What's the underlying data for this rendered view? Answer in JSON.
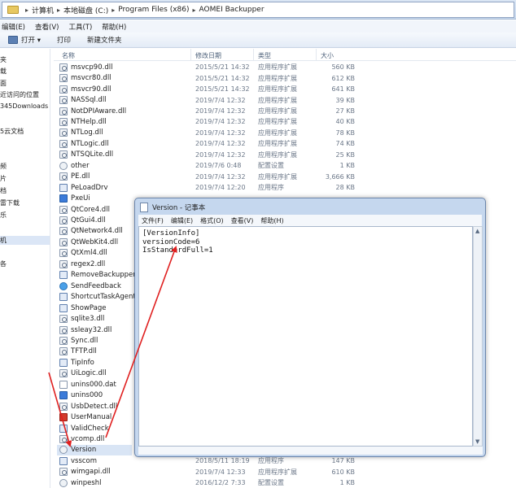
{
  "address": {
    "crumbs": [
      "计算机",
      "本地磁盘 (C:)",
      "Program Files (x86)",
      "AOMEI Backupper"
    ]
  },
  "menu": [
    "编辑(E)",
    "查看(V)",
    "工具(T)",
    "帮助(H)"
  ],
  "toolbar": {
    "open_label": "打开 ▾",
    "print_label": "打印",
    "new_folder_label": "新建文件夹"
  },
  "nav": [
    "夹",
    "载",
    "面",
    "近访问的位置",
    "345Downloads",
    "5云文档",
    "频",
    "片",
    "档",
    "雷下载",
    "乐",
    "机",
    "各"
  ],
  "columns": {
    "name": "名称",
    "date": "修改日期",
    "type": "类型",
    "size": "大小"
  },
  "files": [
    {
      "name": "msvcp90.dll",
      "date": "2015/5/21 14:32",
      "type": "应用程序扩展",
      "size": "560 KB",
      "icon": "dll"
    },
    {
      "name": "msvcr80.dll",
      "date": "2015/5/21 14:32",
      "type": "应用程序扩展",
      "size": "612 KB",
      "icon": "dll"
    },
    {
      "name": "msvcr90.dll",
      "date": "2015/5/21 14:32",
      "type": "应用程序扩展",
      "size": "641 KB",
      "icon": "dll"
    },
    {
      "name": "NASSql.dll",
      "date": "2019/7/4 12:32",
      "type": "应用程序扩展",
      "size": "39 KB",
      "icon": "dll"
    },
    {
      "name": "NotDPIAware.dll",
      "date": "2019/7/4 12:32",
      "type": "应用程序扩展",
      "size": "27 KB",
      "icon": "dll"
    },
    {
      "name": "NTHelp.dll",
      "date": "2019/7/4 12:32",
      "type": "应用程序扩展",
      "size": "40 KB",
      "icon": "dll"
    },
    {
      "name": "NTLog.dll",
      "date": "2019/7/4 12:32",
      "type": "应用程序扩展",
      "size": "78 KB",
      "icon": "dll"
    },
    {
      "name": "NTLogic.dll",
      "date": "2019/7/4 12:32",
      "type": "应用程序扩展",
      "size": "74 KB",
      "icon": "dll"
    },
    {
      "name": "NTSQLite.dll",
      "date": "2019/7/4 12:32",
      "type": "应用程序扩展",
      "size": "25 KB",
      "icon": "dll"
    },
    {
      "name": "other",
      "date": "2019/7/6 0:48",
      "type": "配置设置",
      "size": "1 KB",
      "icon": "cfg"
    },
    {
      "name": "PE.dll",
      "date": "2019/7/4 12:32",
      "type": "应用程序扩展",
      "size": "3,666 KB",
      "icon": "dll"
    },
    {
      "name": "PeLoadDrv",
      "date": "2019/7/4 12:20",
      "type": "应用程序",
      "size": "28 KB",
      "icon": "exe"
    },
    {
      "name": "PxeUi",
      "date": "",
      "type": "",
      "size": "",
      "icon": "blue"
    },
    {
      "name": "QtCore4.dll",
      "date": "",
      "type": "",
      "size": "",
      "icon": "dll"
    },
    {
      "name": "QtGui4.dll",
      "date": "",
      "type": "",
      "size": "",
      "icon": "dll"
    },
    {
      "name": "QtNetwork4.dll",
      "date": "",
      "type": "",
      "size": "",
      "icon": "dll"
    },
    {
      "name": "QtWebKit4.dll",
      "date": "",
      "type": "",
      "size": "",
      "icon": "dll"
    },
    {
      "name": "QtXml4.dll",
      "date": "",
      "type": "",
      "size": "",
      "icon": "dll"
    },
    {
      "name": "regex2.dll",
      "date": "",
      "type": "",
      "size": "",
      "icon": "dll"
    },
    {
      "name": "RemoveBackupper",
      "date": "",
      "type": "",
      "size": "",
      "icon": "exe"
    },
    {
      "name": "SendFeedback",
      "date": "",
      "type": "",
      "size": "",
      "icon": "globe"
    },
    {
      "name": "ShortcutTaskAgent",
      "date": "",
      "type": "",
      "size": "",
      "icon": "exe"
    },
    {
      "name": "ShowPage",
      "date": "",
      "type": "",
      "size": "",
      "icon": "exe"
    },
    {
      "name": "sqlite3.dll",
      "date": "",
      "type": "",
      "size": "",
      "icon": "dll"
    },
    {
      "name": "ssleay32.dll",
      "date": "",
      "type": "",
      "size": "",
      "icon": "dll"
    },
    {
      "name": "Sync.dll",
      "date": "",
      "type": "",
      "size": "",
      "icon": "dll"
    },
    {
      "name": "TFTP.dll",
      "date": "",
      "type": "",
      "size": "",
      "icon": "dll"
    },
    {
      "name": "TipInfo",
      "date": "",
      "type": "",
      "size": "",
      "icon": "exe"
    },
    {
      "name": "UiLogic.dll",
      "date": "",
      "type": "",
      "size": "",
      "icon": "dll"
    },
    {
      "name": "unins000.dat",
      "date": "",
      "type": "",
      "size": "",
      "icon": "txt"
    },
    {
      "name": "unins000",
      "date": "",
      "type": "",
      "size": "",
      "icon": "blue"
    },
    {
      "name": "UsbDetect.dll",
      "date": "",
      "type": "",
      "size": "",
      "icon": "dll"
    },
    {
      "name": "UserManual",
      "date": "",
      "type": "",
      "size": "",
      "icon": "pdf"
    },
    {
      "name": "ValidCheck",
      "date": "",
      "type": "",
      "size": "",
      "icon": "exe"
    },
    {
      "name": "vcomp.dll",
      "date": "",
      "type": "",
      "size": "",
      "icon": "dll"
    },
    {
      "name": "Version",
      "date": "",
      "type": "",
      "size": "",
      "icon": "cfg"
    },
    {
      "name": "vsscom",
      "date": "2018/5/11 18:19",
      "type": "应用程序",
      "size": "147 KB",
      "icon": "exe"
    },
    {
      "name": "wimgapi.dll",
      "date": "2019/7/4 12:33",
      "type": "应用程序扩展",
      "size": "610 KB",
      "icon": "dll"
    },
    {
      "name": "winpeshl",
      "date": "2016/12/2 7:33",
      "type": "配置设置",
      "size": "1 KB",
      "icon": "cfg"
    }
  ],
  "selected_file": "Version",
  "notepad": {
    "title": "Version - 记事本",
    "menu": [
      "文件(F)",
      "编辑(E)",
      "格式(O)",
      "查看(V)",
      "帮助(H)"
    ],
    "content": "[VersionInfo]\nversionCode=6\nIsStandardFull=1"
  },
  "colors": {
    "annotation_arrow": "#e02020",
    "selection": "#d9e5f5",
    "notepad_frame": "#c5d7ee"
  }
}
